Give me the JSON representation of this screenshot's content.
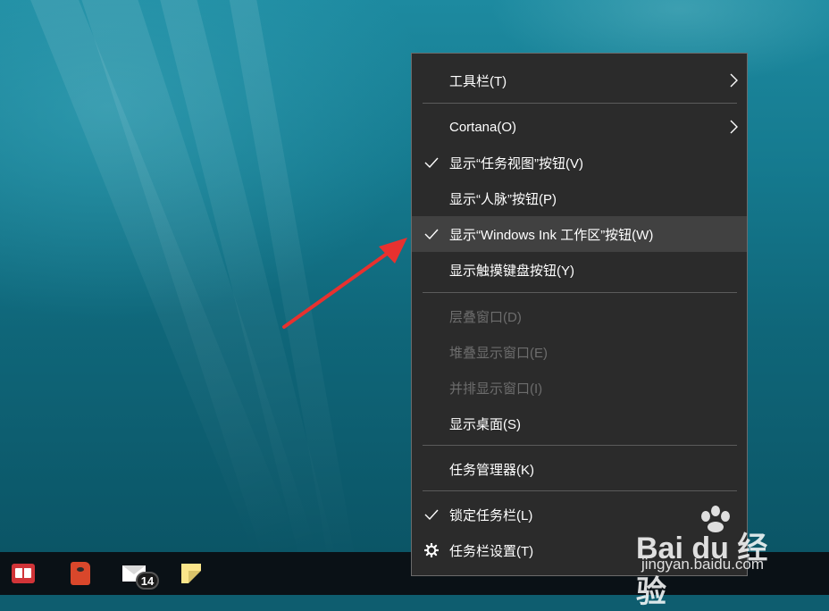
{
  "menu": {
    "items": [
      {
        "label": "工具栏(T)",
        "checked": false,
        "submenu": true
      },
      {
        "label": "Cortana(O)",
        "checked": false,
        "submenu": true
      },
      {
        "label": "显示“任务视图”按钮(V)",
        "checked": true
      },
      {
        "label": "显示“人脉”按钮(P)",
        "checked": false
      },
      {
        "label": "显示“Windows Ink 工作区”按钮(W)",
        "checked": true,
        "highlighted": true
      },
      {
        "label": "显示触摸键盘按钮(Y)",
        "checked": false
      },
      {
        "label": "层叠窗口(D)",
        "disabled": true
      },
      {
        "label": "堆叠显示窗口(E)",
        "disabled": true
      },
      {
        "label": "并排显示窗口(I)",
        "disabled": true
      },
      {
        "label": "显示桌面(S)"
      },
      {
        "label": "任务管理器(K)"
      },
      {
        "label": "锁定任务栏(L)",
        "checked": true
      },
      {
        "label": "任务栏设置(T)",
        "icon": "gear-icon"
      }
    ]
  },
  "taskbar": {
    "apps": [
      {
        "icon": "book-app-icon"
      },
      {
        "icon": "reader-app-icon"
      },
      {
        "icon": "mail-icon",
        "badge": "14"
      },
      {
        "icon": "sticky-notes-icon"
      }
    ]
  },
  "watermark": {
    "logo": "Bai du 经验",
    "url": "jingyan.baidu.com"
  },
  "colors": {
    "menu_bg": "#2b2b2b",
    "highlight": "#414141",
    "arrow": "#e8312f",
    "taskbar": "#0a1116"
  }
}
